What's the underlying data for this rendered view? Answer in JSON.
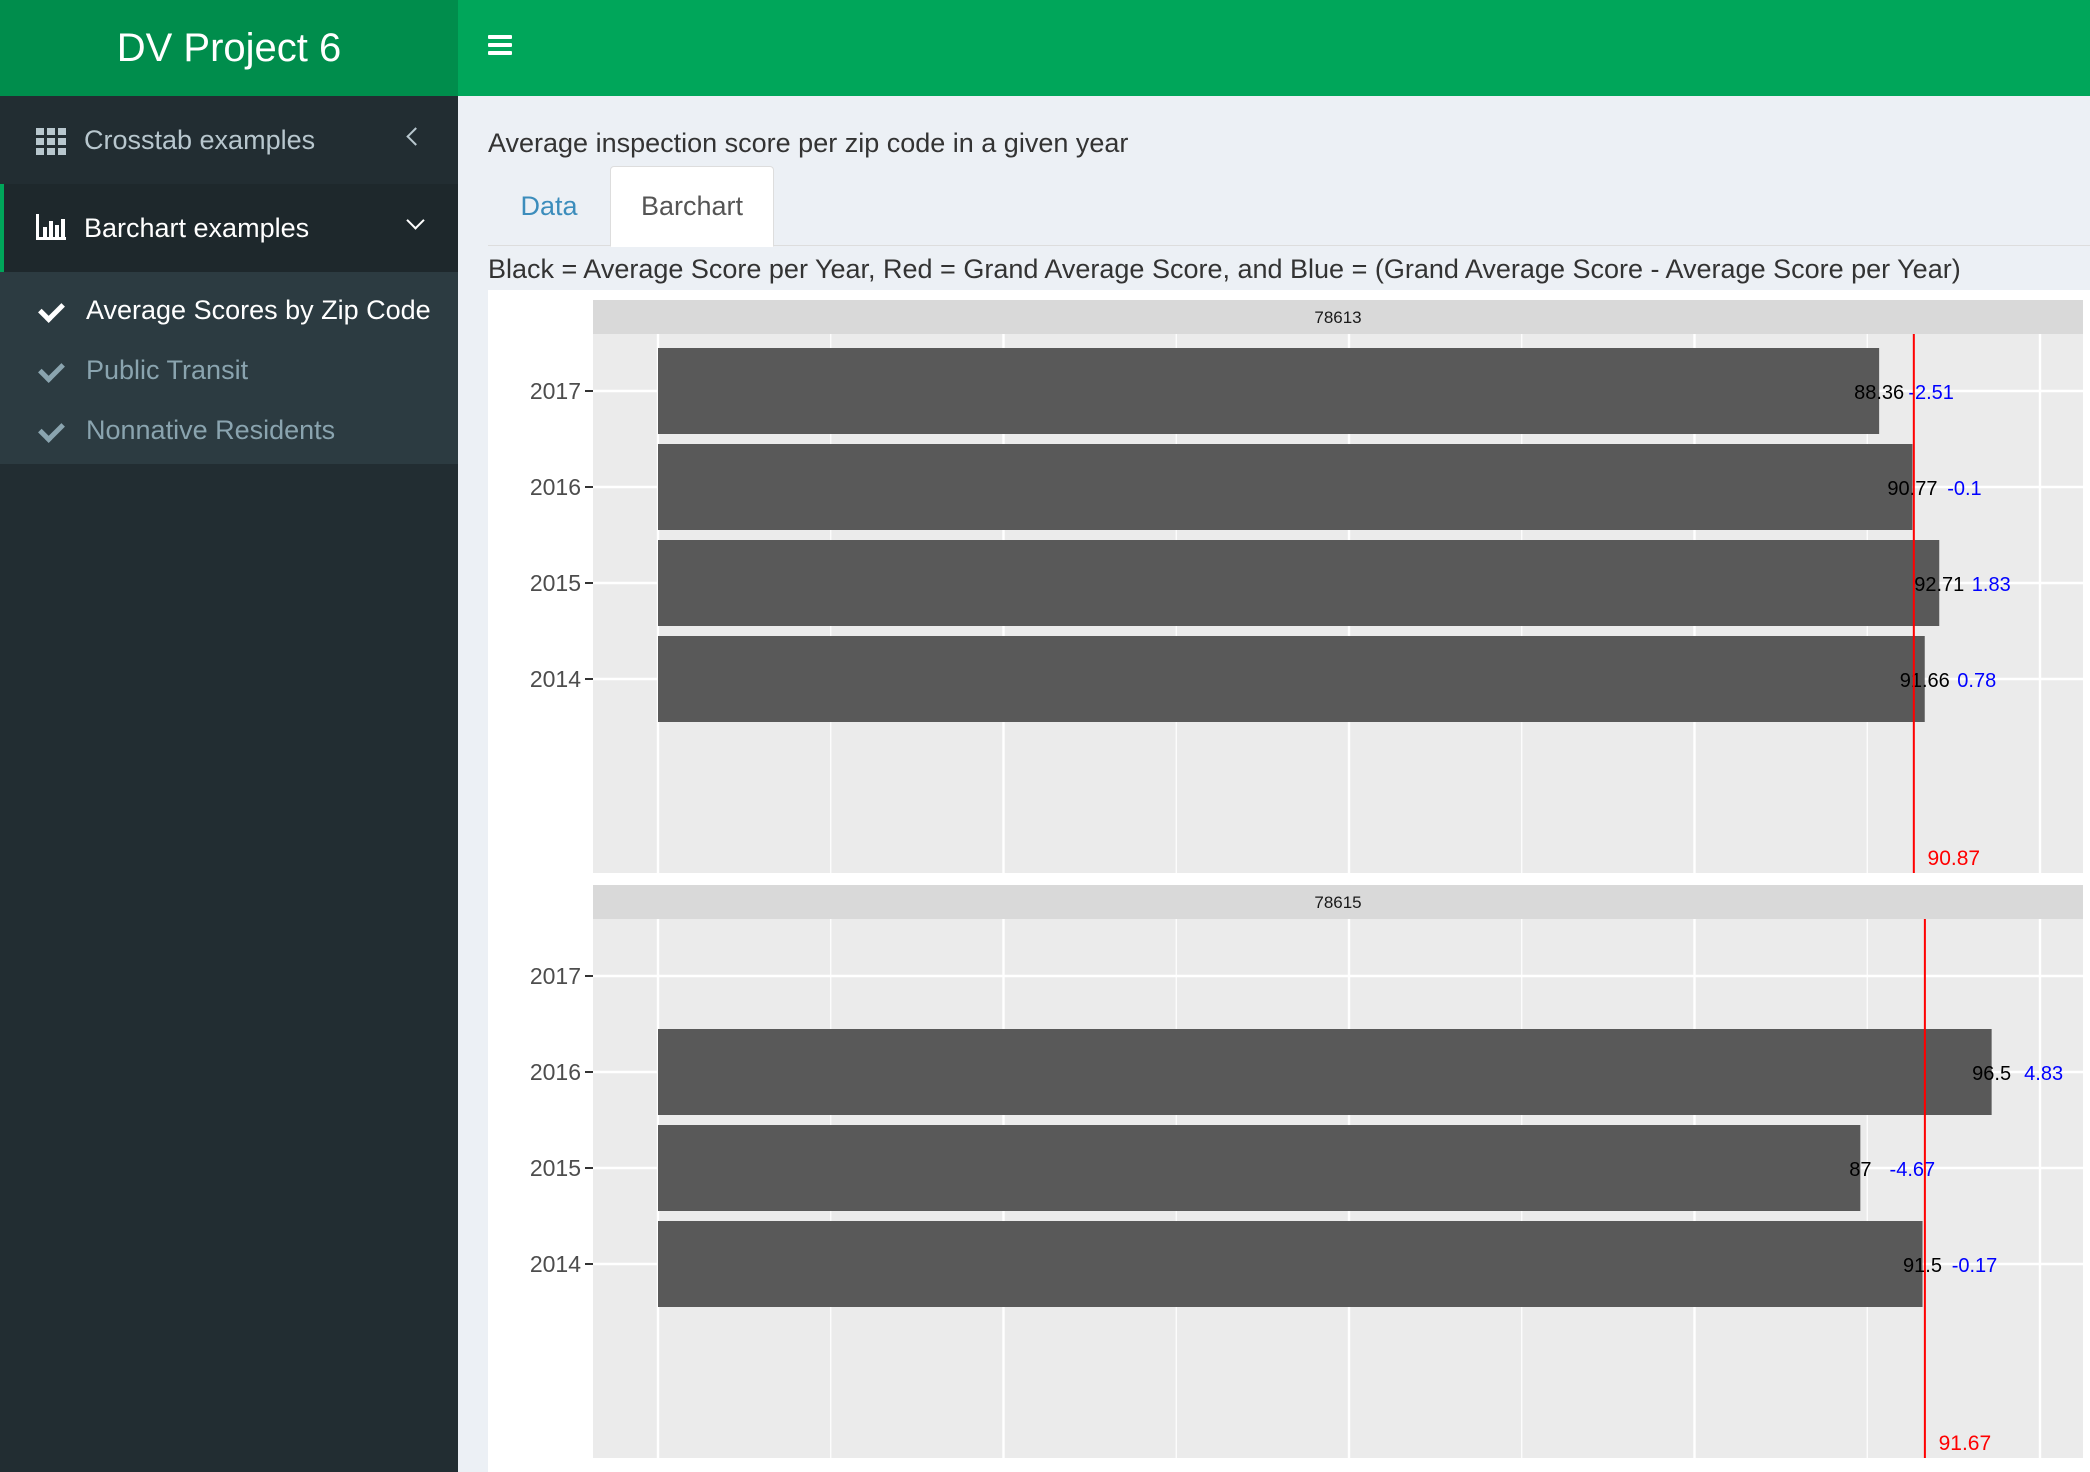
{
  "header": {
    "brand_title": "DV Project 6",
    "menu_toggle_icon": "hamburger-icon"
  },
  "sidebar": {
    "items": [
      {
        "label": "Crosstab examples",
        "icon": "grid-icon",
        "caret": "chevron-left-icon",
        "active": false
      },
      {
        "label": "Barchart examples",
        "icon": "bar-chart-icon",
        "caret": "chevron-down-icon",
        "active": true
      }
    ],
    "subitems": [
      {
        "label": "Average Scores by Zip Code",
        "icon": "check-icon",
        "active": true
      },
      {
        "label": "Public Transit",
        "icon": "check-icon",
        "active": false
      },
      {
        "label": "Nonnative Residents",
        "icon": "check-icon",
        "active": false
      }
    ]
  },
  "main": {
    "title": "Average inspection score per zip code in a given year",
    "tabs": [
      {
        "label": "Data",
        "active": false
      },
      {
        "label": "Barchart",
        "active": true
      }
    ],
    "legend_text": "Black = Average Score per Year, Red = Grand Average Score, and Blue = (Grand Average Score - Average Score per Year)"
  },
  "colors": {
    "header_brand": "#008d4c",
    "header_bar": "#00a65a",
    "sidebar_bg": "#222d32",
    "bar_fill": "#595959",
    "avg_line": "#ff0000",
    "diff_label": "#0000ff"
  },
  "chart_data": {
    "type": "bar",
    "orientation": "horizontal",
    "categories": [
      "2017",
      "2016",
      "2015",
      "2014"
    ],
    "xlim": [
      0,
      100
    ],
    "grid": true,
    "facets": [
      {
        "label": "78613",
        "grand_average": 90.87,
        "grand_average_label": "90.87",
        "bars": [
          {
            "year": "2017",
            "value": 88.36,
            "label": "88.36",
            "diff": -2.51,
            "diff_label": "-2.51"
          },
          {
            "year": "2016",
            "value": 90.77,
            "label": "90.77",
            "diff": -0.1,
            "diff_label": "-0.1"
          },
          {
            "year": "2015",
            "value": 92.71,
            "label": "92.71",
            "diff": 1.83,
            "diff_label": "1.83"
          },
          {
            "year": "2014",
            "value": 91.66,
            "label": "91.66",
            "diff": 0.78,
            "diff_label": "0.78"
          }
        ]
      },
      {
        "label": "78615",
        "grand_average": 91.67,
        "grand_average_label": "91.67",
        "bars": [
          {
            "year": "2016",
            "value": 96.5,
            "label": "96.5",
            "diff": 4.83,
            "diff_label": "4.83"
          },
          {
            "year": "2015",
            "value": 87,
            "label": "87",
            "diff": -4.67,
            "diff_label": "-4.67"
          },
          {
            "year": "2014",
            "value": 91.5,
            "label": "91.5",
            "diff": -0.17,
            "diff_label": "-0.17"
          }
        ]
      }
    ]
  }
}
